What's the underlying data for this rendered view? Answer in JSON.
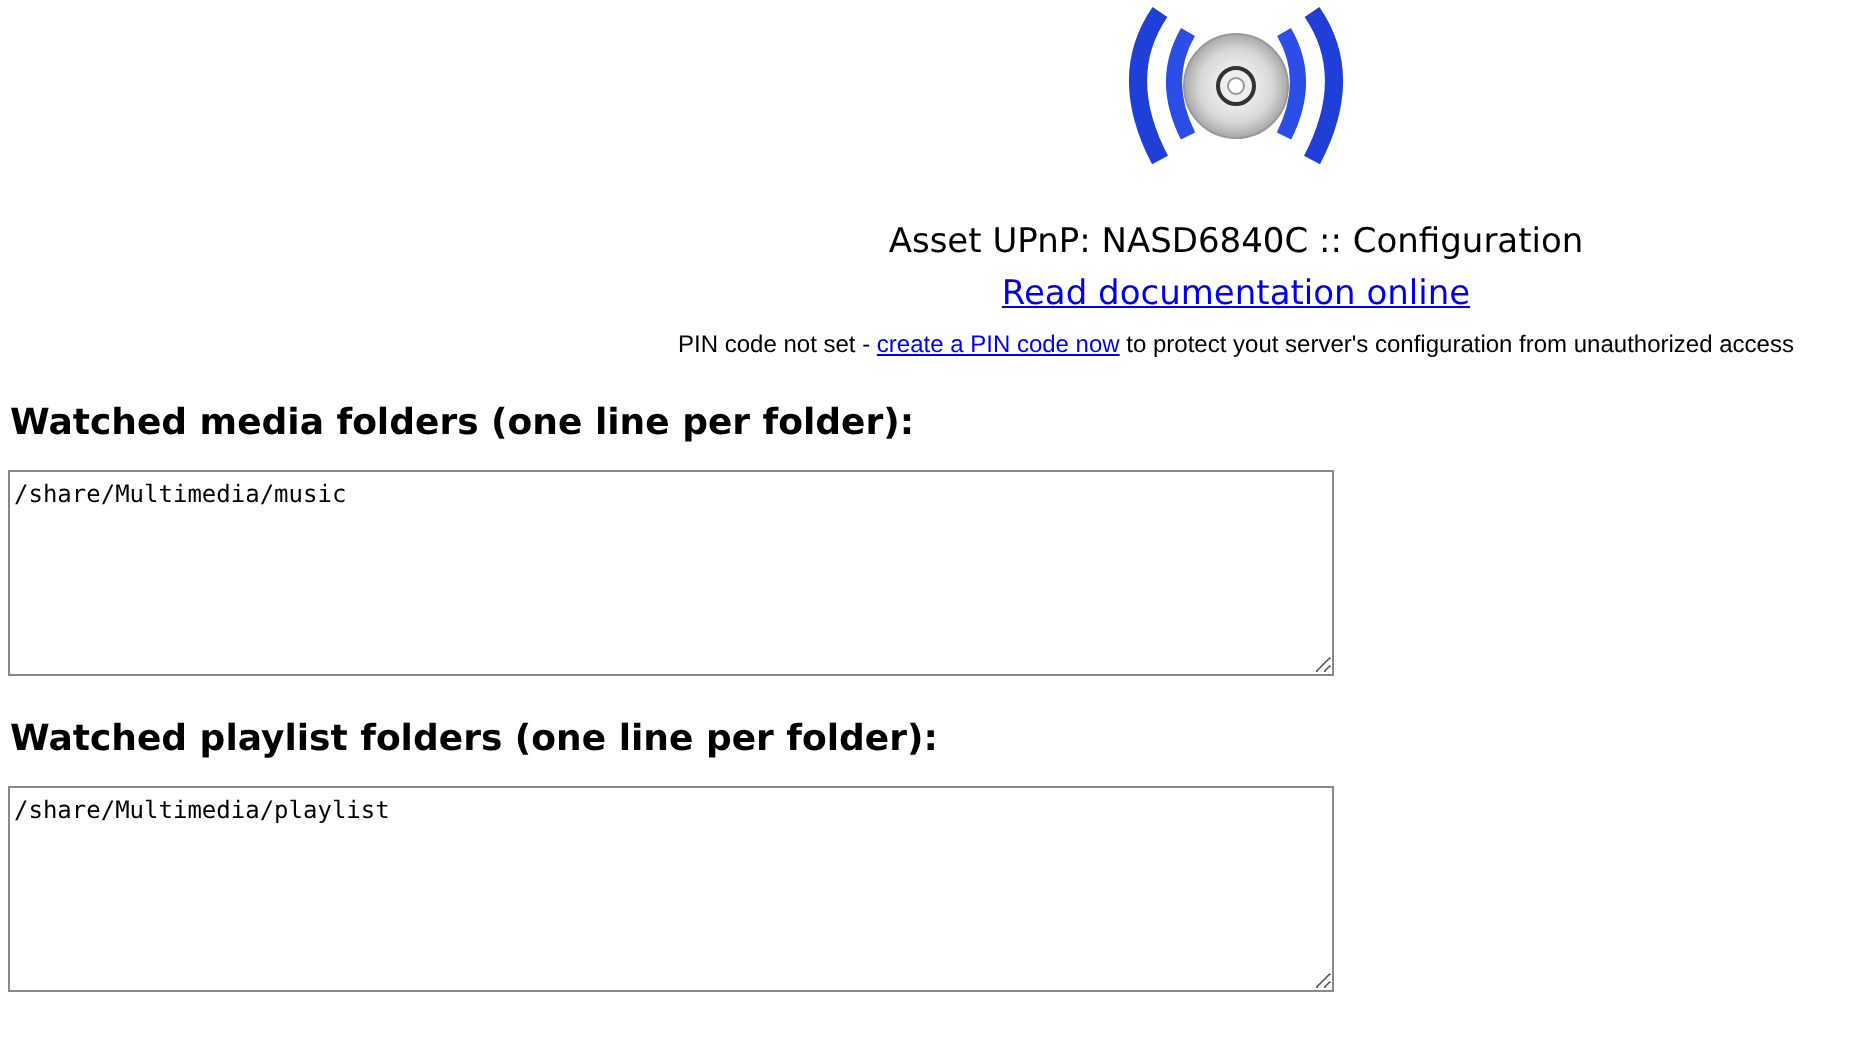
{
  "header": {
    "title": "Asset UPnP: NASD6840C :: Configuration",
    "doc_link": "Read documentation online",
    "pin_notice": {
      "before": "PIN code not set - ",
      "link": "create a PIN code now",
      "after": " to protect yout server's configuration from unauthorized access"
    }
  },
  "sections": [
    {
      "heading": "Watched media folders (one line per folder):",
      "value": "/share/Multimedia/music"
    },
    {
      "heading": "Watched playlist folders (one line per folder):",
      "value": "/share/Multimedia/playlist"
    }
  ]
}
